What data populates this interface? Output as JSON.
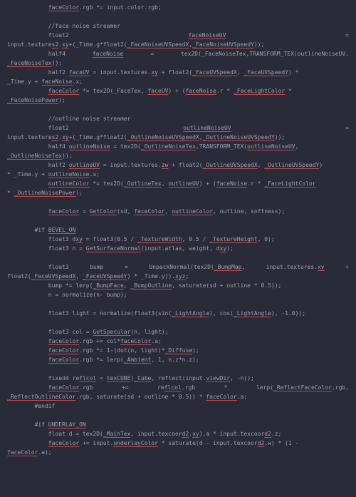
{
  "lines": [
    {
      "indent": 12,
      "segs": [
        {
          "t": "faceColor",
          "u": 1
        },
        {
          "t": ".rgb *= input.color.rgb;"
        }
      ]
    },
    {
      "indent": 0,
      "segs": [
        {
          "t": ""
        }
      ]
    },
    {
      "indent": 12,
      "segs": [
        {
          "t": "//face noise streamer"
        }
      ]
    },
    {
      "indent": 12,
      "just": true,
      "segs": [
        {
          "t": "float2"
        },
        {
          "t": "faceNoiseUV",
          "u": 1
        },
        {
          "t": "="
        }
      ]
    },
    {
      "indent": 0,
      "segs": [
        {
          "t": "input.texture"
        },
        {
          "t": "s2",
          "u": 1
        },
        {
          "t": "."
        },
        {
          "t": "xy",
          "u": 1
        },
        {
          "t": "+(_Time.g*float2("
        },
        {
          "t": "_FaceNoiseUVSpeedX",
          "u": 1
        },
        {
          "t": ","
        },
        {
          "t": "_FaceNoiseUVSpeedY",
          "u": 1
        },
        {
          "t": "));"
        }
      ]
    },
    {
      "indent": 12,
      "just": true,
      "segs": [
        {
          "t": "half4"
        },
        {
          "t": "faceNoise",
          "u": 1
        },
        {
          "t": "="
        },
        {
          "t": "tex2D(_FaceNoiseTex,TRANSFORM_TEX(outlineNoiseUV,"
        }
      ]
    },
    {
      "indent": 0,
      "segs": [
        {
          "t": "_FaceNoiseTex",
          "u": 1
        },
        {
          "t": "));"
        }
      ]
    },
    {
      "indent": 12,
      "segs": [
        {
          "t": "half2 "
        },
        {
          "t": "faceUV",
          "u": 1
        },
        {
          "t": " = input.textures."
        },
        {
          "t": "xy",
          "u": 1
        },
        {
          "t": " + float2("
        },
        {
          "t": "_FaceUVSpeedX",
          "u": 1
        },
        {
          "t": ", "
        },
        {
          "t": "_FaceUVSpeedY",
          "u": 1
        },
        {
          "t": ") *"
        }
      ]
    },
    {
      "indent": 0,
      "segs": [
        {
          "t": "_Time.y + "
        },
        {
          "t": "faceNoise",
          "u": 1
        },
        {
          "t": ".x;"
        }
      ]
    },
    {
      "indent": 12,
      "segs": [
        {
          "t": "faceColor",
          "u": 1
        },
        {
          "t": " *= tex2D(_FaceTex, "
        },
        {
          "t": "faceUV",
          "u": 1
        },
        {
          "t": ") + ("
        },
        {
          "t": "faceNoise",
          "u": 1
        },
        {
          "t": ".r * "
        },
        {
          "t": "_FaceLightColor",
          "u": 1
        },
        {
          "t": " *"
        }
      ]
    },
    {
      "indent": 0,
      "segs": [
        {
          "t": "_FaceNoisePower",
          "u": 1
        },
        {
          "t": ");"
        }
      ]
    },
    {
      "indent": 0,
      "segs": [
        {
          "t": ""
        }
      ]
    },
    {
      "indent": 12,
      "segs": [
        {
          "t": "//outline noise streamer"
        }
      ]
    },
    {
      "indent": 12,
      "just": true,
      "segs": [
        {
          "t": "float2"
        },
        {
          "t": "outlineNoiseUV",
          "u": 1
        },
        {
          "t": "="
        }
      ]
    },
    {
      "indent": 0,
      "segs": [
        {
          "t": "input.texture"
        },
        {
          "t": "s2",
          "u": 1
        },
        {
          "t": "."
        },
        {
          "t": "xy",
          "u": 1
        },
        {
          "t": "+(_Time.g*float2("
        },
        {
          "t": "_OutlineNoiseUVSpeedX",
          "u": 1
        },
        {
          "t": ","
        },
        {
          "t": "_OutlineNoiseUVSpeedY",
          "u": 1
        },
        {
          "t": "));"
        }
      ]
    },
    {
      "indent": 12,
      "segs": [
        {
          "t": "half4 "
        },
        {
          "t": "outlineNoise",
          "u": 1
        },
        {
          "t": " = tex2D("
        },
        {
          "t": "_OutlineNoiseTex",
          "u": 1
        },
        {
          "t": ",TRANSFORM_TEX("
        },
        {
          "t": "outlineNoiseUV",
          "u": 1
        },
        {
          "t": ","
        }
      ]
    },
    {
      "indent": 0,
      "segs": [
        {
          "t": "_OutlineNoiseTex",
          "u": 1
        },
        {
          "t": "));"
        }
      ]
    },
    {
      "indent": 12,
      "segs": [
        {
          "t": "half2 "
        },
        {
          "t": "outlineUV",
          "u": 1
        },
        {
          "t": " = input.textures."
        },
        {
          "t": "zw",
          "u": 1
        },
        {
          "t": " + float2("
        },
        {
          "t": "_OutlineUVSpeedX",
          "u": 1
        },
        {
          "t": ", "
        },
        {
          "t": "_OutlineUVSpeedY",
          "u": 1
        },
        {
          "t": ")"
        }
      ]
    },
    {
      "indent": 0,
      "segs": [
        {
          "t": "* _Time.y + "
        },
        {
          "t": "outlineNoise",
          "u": 1
        },
        {
          "t": ".x;"
        }
      ]
    },
    {
      "indent": 12,
      "segs": [
        {
          "t": "outlineColor",
          "u": 1
        },
        {
          "t": " *= tex2D("
        },
        {
          "t": "_OutlineTex",
          "u": 1
        },
        {
          "t": ", "
        },
        {
          "t": "outlineUV",
          "u": 1
        },
        {
          "t": ") + ("
        },
        {
          "t": "faceNoise",
          "u": 1
        },
        {
          "t": ".r * "
        },
        {
          "t": "_FaceLightColor",
          "u": 1
        }
      ]
    },
    {
      "indent": 0,
      "segs": [
        {
          "t": "* "
        },
        {
          "t": "_OutlineNoisePower",
          "u": 1
        },
        {
          "t": ");"
        }
      ]
    },
    {
      "indent": 0,
      "segs": [
        {
          "t": ""
        }
      ]
    },
    {
      "indent": 12,
      "segs": [
        {
          "t": "faceColor",
          "u": 1
        },
        {
          "t": " = "
        },
        {
          "t": "GetColor",
          "u": 1
        },
        {
          "t": "(sd, "
        },
        {
          "t": "faceColor",
          "u": 1
        },
        {
          "t": ", "
        },
        {
          "t": "outlineColor",
          "u": 1
        },
        {
          "t": ", outline, softness);"
        }
      ]
    },
    {
      "indent": 0,
      "segs": [
        {
          "t": ""
        }
      ]
    },
    {
      "indent": 8,
      "segs": [
        {
          "t": "#if "
        },
        {
          "t": "BEVEL_ON",
          "u": 1
        }
      ]
    },
    {
      "indent": 12,
      "segs": [
        {
          "t": "float3 d"
        },
        {
          "t": "xy",
          "u": 1
        },
        {
          "t": " = float3(0.5 / "
        },
        {
          "t": "_TextureWidth",
          "u": 1
        },
        {
          "t": ", 0.5 / "
        },
        {
          "t": "_TextureHeight",
          "u": 1
        },
        {
          "t": ", 0);"
        }
      ]
    },
    {
      "indent": 12,
      "segs": [
        {
          "t": "float3 n = "
        },
        {
          "t": "GetSurfaceNormal",
          "u": 1
        },
        {
          "t": "(input.atlas, weight, d"
        },
        {
          "t": "xy",
          "u": 1
        },
        {
          "t": ");"
        }
      ]
    },
    {
      "indent": 0,
      "segs": [
        {
          "t": ""
        }
      ]
    },
    {
      "indent": 12,
      "just": true,
      "segs": [
        {
          "t": "float3"
        },
        {
          "t": "bump"
        },
        {
          "t": "="
        },
        {
          "t": "UnpackNormal(tex2D(_BumpMap,",
          "u": 0,
          "parts": [
            {
              "t": "UnpackNormal(tex2D("
            },
            {
              "t": "_BumpMap",
              "u": 1
            },
            {
              "t": ","
            }
          ]
        },
        {
          "t": "input.textures.xy",
          "parts": [
            {
              "t": "input.textures."
            },
            {
              "t": "xy",
              "u": 1
            }
          ]
        },
        {
          "t": "+"
        }
      ]
    },
    {
      "indent": 0,
      "segs": [
        {
          "t": "float2("
        },
        {
          "t": "_FaceUVSpeedX",
          "u": 1
        },
        {
          "t": ", "
        },
        {
          "t": "_FaceUVSpeedY",
          "u": 1
        },
        {
          "t": ") * _Time.y))."
        },
        {
          "t": "xyz",
          "u": 1
        },
        {
          "t": ";"
        }
      ]
    },
    {
      "indent": 12,
      "segs": [
        {
          "t": "bump *= lerp("
        },
        {
          "t": "_BumpFace",
          "u": 1
        },
        {
          "t": ", "
        },
        {
          "t": "_BumpOutline",
          "u": 1
        },
        {
          "t": ", saturate(sd + outline * 0.5));"
        }
      ]
    },
    {
      "indent": 12,
      "segs": [
        {
          "t": "n = normalize(n- bump);"
        }
      ]
    },
    {
      "indent": 0,
      "segs": [
        {
          "t": ""
        }
      ]
    },
    {
      "indent": 12,
      "segs": [
        {
          "t": "float3 light = normalize(float3(sin("
        },
        {
          "t": "_LightAngle",
          "u": 1
        },
        {
          "t": "), cos("
        },
        {
          "t": "_LightAngle",
          "u": 1
        },
        {
          "t": "), -1.0));"
        }
      ]
    },
    {
      "indent": 0,
      "segs": [
        {
          "t": ""
        }
      ]
    },
    {
      "indent": 12,
      "segs": [
        {
          "t": "float3 col = "
        },
        {
          "t": "GetSpecular",
          "u": 1
        },
        {
          "t": "(n, light);"
        }
      ]
    },
    {
      "indent": 12,
      "segs": [
        {
          "t": "faceColor",
          "u": 1
        },
        {
          "t": ".rgb += col*"
        },
        {
          "t": "faceColor",
          "u": 1
        },
        {
          "t": ".a;"
        }
      ]
    },
    {
      "indent": 12,
      "segs": [
        {
          "t": "faceColor",
          "u": 1
        },
        {
          "t": ".rgb *= 1-(dot(n, light)*"
        },
        {
          "t": "_Diffuse",
          "u": 1
        },
        {
          "t": ");"
        }
      ]
    },
    {
      "indent": 12,
      "segs": [
        {
          "t": "faceColor",
          "u": 1
        },
        {
          "t": ".rgb *= lerp("
        },
        {
          "t": "_Ambient",
          "u": 1
        },
        {
          "t": ", 1, n.z*n.z);"
        }
      ]
    },
    {
      "indent": 0,
      "segs": [
        {
          "t": ""
        }
      ]
    },
    {
      "indent": 12,
      "segs": [
        {
          "t": "fixed4 re"
        },
        {
          "t": "flcol",
          "u": 1
        },
        {
          "t": " = "
        },
        {
          "t": "texCUBE",
          "u": 1
        },
        {
          "t": "("
        },
        {
          "t": "_Cube",
          "u": 1
        },
        {
          "t": ", reflect(input."
        },
        {
          "t": "viewDir",
          "u": 1
        },
        {
          "t": ", -n));"
        }
      ]
    },
    {
      "indent": 12,
      "just": true,
      "segs": [
        {
          "t": "faceColor.rgb",
          "parts": [
            {
              "t": "faceColor",
              "u": 1
            },
            {
              "t": ".rgb"
            }
          ]
        },
        {
          "t": "+="
        },
        {
          "t": "reflcol.rgb",
          "parts": [
            {
              "t": "re"
            },
            {
              "t": "flcol",
              "u": 1
            },
            {
              "t": ".rgb"
            }
          ]
        },
        {
          "t": "*"
        },
        {
          "t": "lerp(_ReflectFaceColor.rgb,",
          "parts": [
            {
              "t": "lerp("
            },
            {
              "t": "_ReflectFaceColor",
              "u": 1
            },
            {
              "t": ".rgb,"
            }
          ]
        }
      ]
    },
    {
      "indent": 0,
      "segs": [
        {
          "t": "_ReflectOutlineColor",
          "u": 1
        },
        {
          "t": ".rgb, saturate(sd + outline * 0.5)) * "
        },
        {
          "t": "faceColor",
          "u": 1
        },
        {
          "t": ".a;"
        }
      ]
    },
    {
      "indent": 8,
      "segs": [
        {
          "t": "#endif"
        }
      ]
    },
    {
      "indent": 0,
      "segs": [
        {
          "t": ""
        }
      ]
    },
    {
      "indent": 8,
      "segs": [
        {
          "t": "#if "
        },
        {
          "t": "UNDERLAY_ON",
          "u": 1
        }
      ]
    },
    {
      "indent": 12,
      "segs": [
        {
          "t": "float d = tex2D("
        },
        {
          "t": "_MainTex",
          "u": 1
        },
        {
          "t": ", input.texcoor"
        },
        {
          "t": "d2",
          "u": 1
        },
        {
          "t": "."
        },
        {
          "t": "xy",
          "u": 1
        },
        {
          "t": ").a * input.texcoor"
        },
        {
          "t": "d2",
          "u": 1
        },
        {
          "t": ".z;"
        }
      ]
    },
    {
      "indent": 12,
      "segs": [
        {
          "t": "faceColor",
          "u": 1
        },
        {
          "t": " += input."
        },
        {
          "t": "underlayColor",
          "u": 1
        },
        {
          "t": " * saturate(d - input.texcoor"
        },
        {
          "t": "d2",
          "u": 1
        },
        {
          "t": ".w) * (1 -"
        }
      ]
    },
    {
      "indent": 0,
      "segs": [
        {
          "t": "faceColor",
          "u": 1
        },
        {
          "t": ".a);"
        }
      ]
    }
  ]
}
